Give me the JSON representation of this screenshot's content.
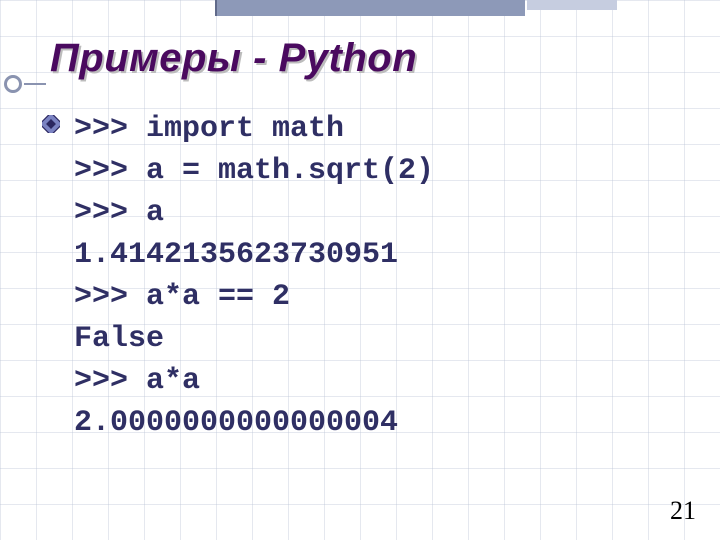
{
  "slide": {
    "title": "Примеры - Python",
    "page_number": "21"
  },
  "code": {
    "l1": ">>> import math",
    "l2": ">>> a = math.sqrt(2)",
    "l3": ">>> a",
    "l4": "1.4142135623730951",
    "l5": ">>> a*a == 2",
    "l6": "False",
    "l7": ">>> a*a",
    "l8": "2.0000000000000004"
  }
}
